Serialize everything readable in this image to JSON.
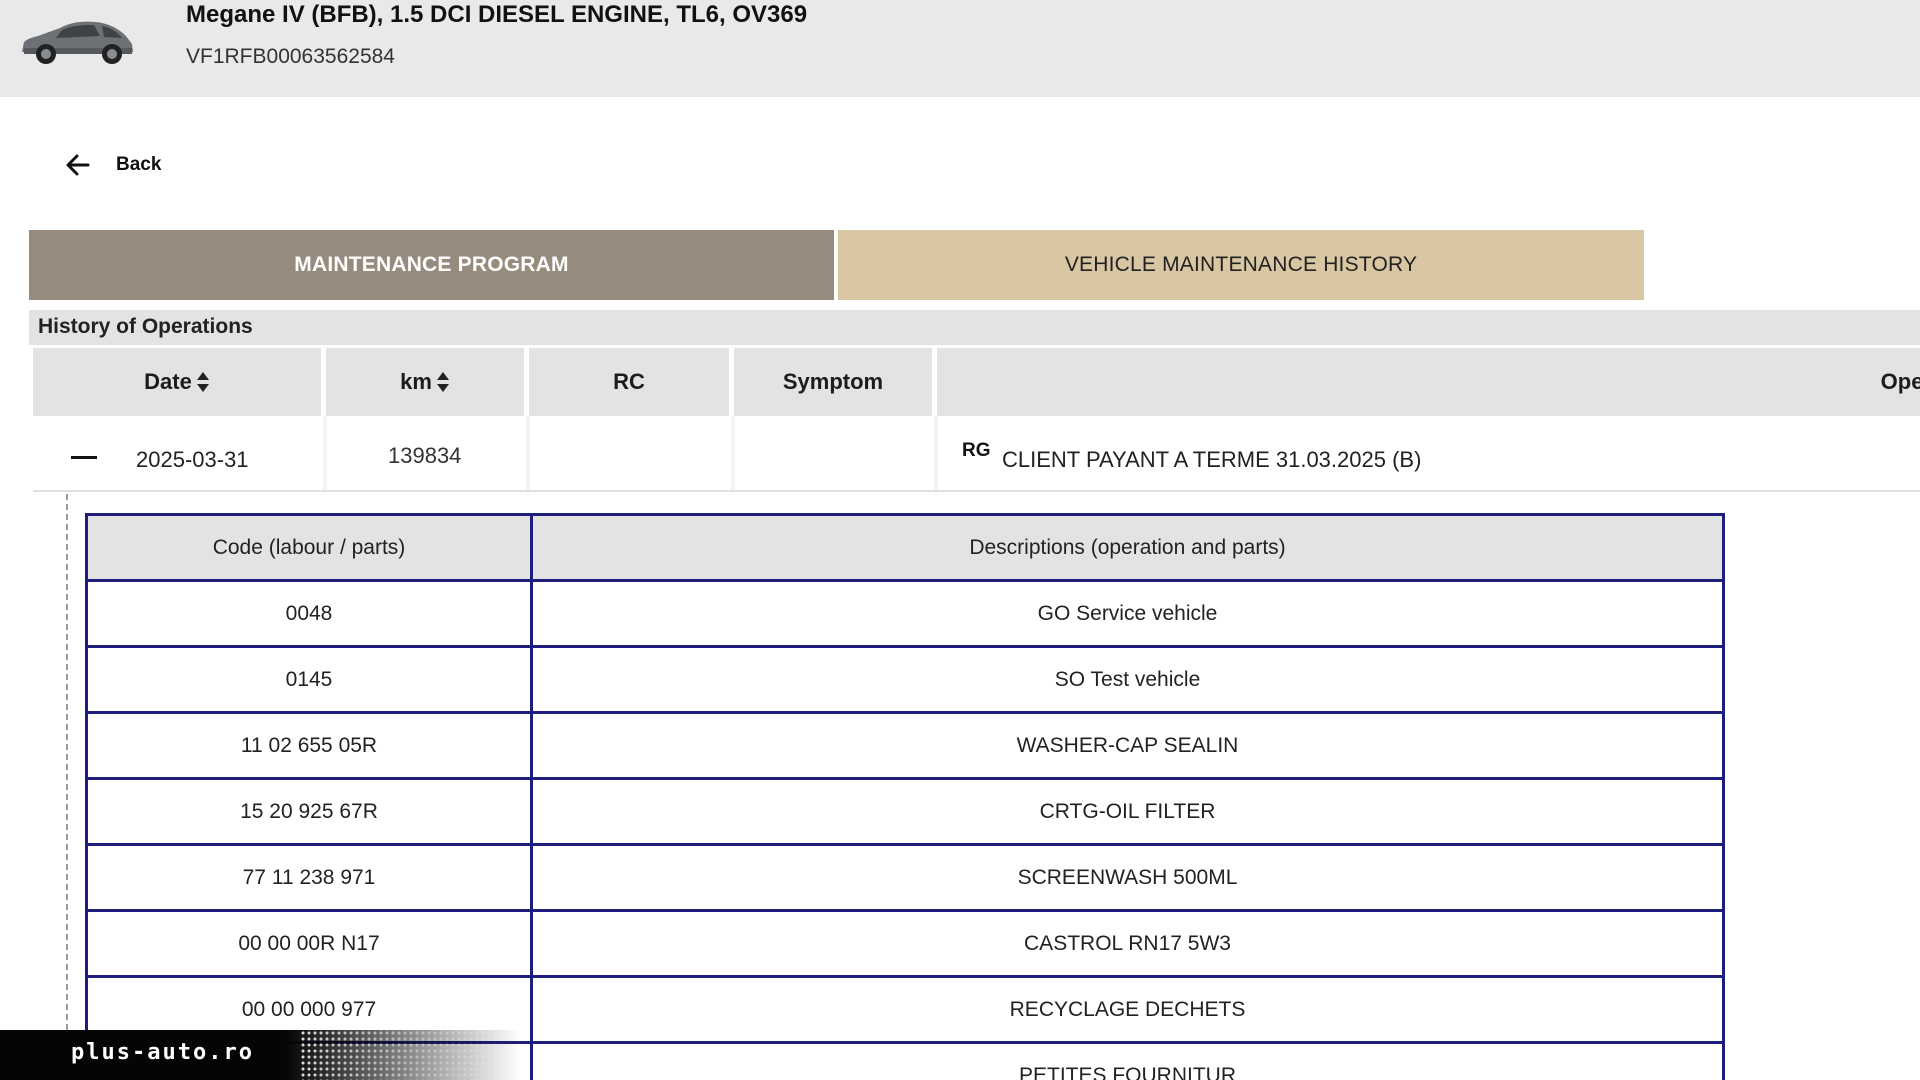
{
  "vehicle": {
    "title": "Megane IV (BFB), 1.5 DCI DIESEL ENGINE, TL6, OV369",
    "vin": "VF1RFB00063562584"
  },
  "navigation": {
    "back_label": "Back"
  },
  "tabs": [
    {
      "label": "MAINTENANCE PROGRAM",
      "active": true
    },
    {
      "label": "VEHICLE MAINTENANCE HISTORY",
      "active": false
    }
  ],
  "history": {
    "title": "History of Operations",
    "columns": {
      "date": "Date",
      "km": "km",
      "rc": "RC",
      "symptom": "Symptom",
      "operation": "Oper"
    },
    "rows": [
      {
        "date": "2025-03-31",
        "km": "139834",
        "rc": "",
        "symptom": "",
        "operation_code": "RG",
        "operation": "CLIENT PAYANT A TERME 31.03.2025 (B)",
        "expanded": true
      }
    ]
  },
  "details": {
    "headers": {
      "code": "Code (labour / parts)",
      "description": "Descriptions (operation and parts)"
    },
    "items": [
      {
        "code": "0048",
        "description": "GO Service vehicle"
      },
      {
        "code": "0145",
        "description": "SO Test vehicle"
      },
      {
        "code": "11 02 655 05R",
        "description": "WASHER-CAP SEALIN"
      },
      {
        "code": "15 20 925 67R",
        "description": "CRTG-OIL FILTER"
      },
      {
        "code": "77 11 238 971",
        "description": "SCREENWASH 500ML"
      },
      {
        "code": "00 00 00R N17",
        "description": "CASTROL RN17 5W3"
      },
      {
        "code": "00 00 000 977",
        "description": "RECYCLAGE DECHETS"
      },
      {
        "code": "",
        "description": "PETITES FOURNITUR"
      }
    ]
  },
  "watermark": {
    "text": "plus-auto.ro"
  },
  "colors": {
    "header_bg": "#e9e9e9",
    "tab_active": "#978b7d",
    "tab_inactive": "#d8c7a2",
    "table_border": "#1e1f7c"
  }
}
